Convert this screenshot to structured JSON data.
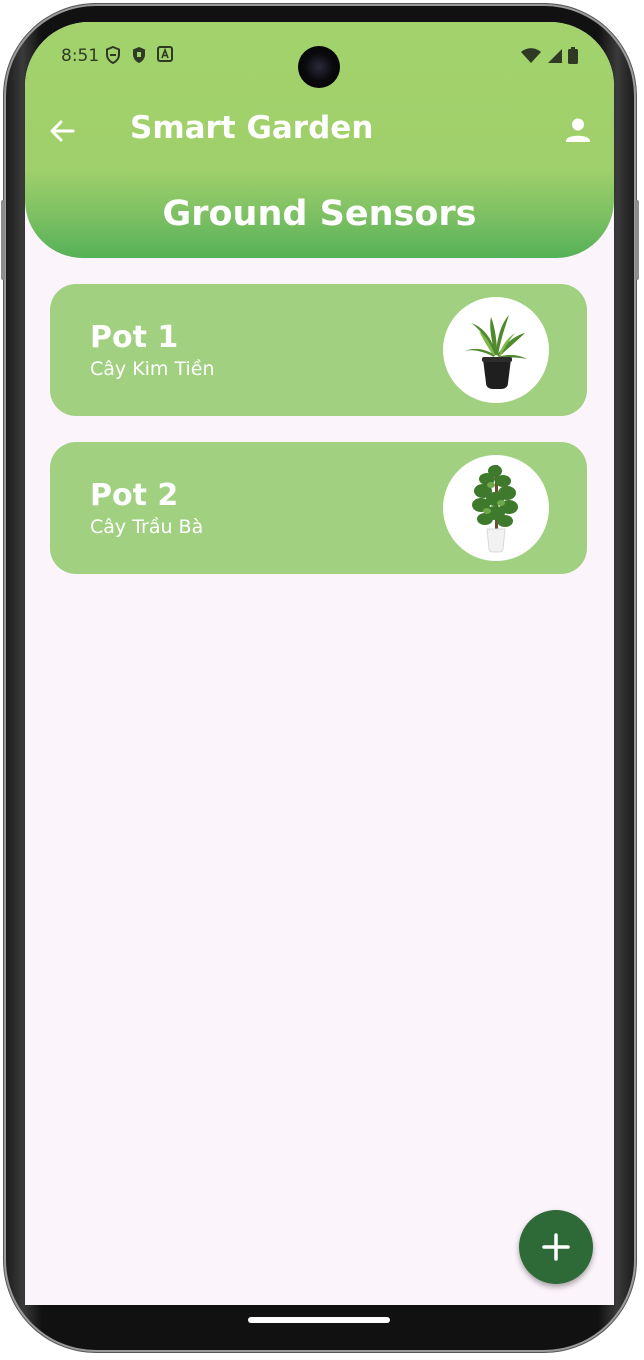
{
  "status_bar": {
    "time": "8:51"
  },
  "app_bar": {
    "title": "Smart Garden",
    "back_icon": "arrow-left-icon",
    "profile_icon": "person-icon"
  },
  "page": {
    "section_title": "Ground Sensors"
  },
  "pots": [
    {
      "name": "Pot 1",
      "plant": "Cây Kim Tiền",
      "image_icon": "potted-plant-icon"
    },
    {
      "name": "Pot 2",
      "plant": "Cây Trầu Bà",
      "image_icon": "pothos-plant-icon"
    }
  ],
  "fab": {
    "icon": "plus-icon"
  },
  "colors": {
    "header_green": "#a3d26c",
    "card_green": "#a1d081",
    "fab_green": "#2d6a37",
    "background": "#fcf4fb"
  }
}
